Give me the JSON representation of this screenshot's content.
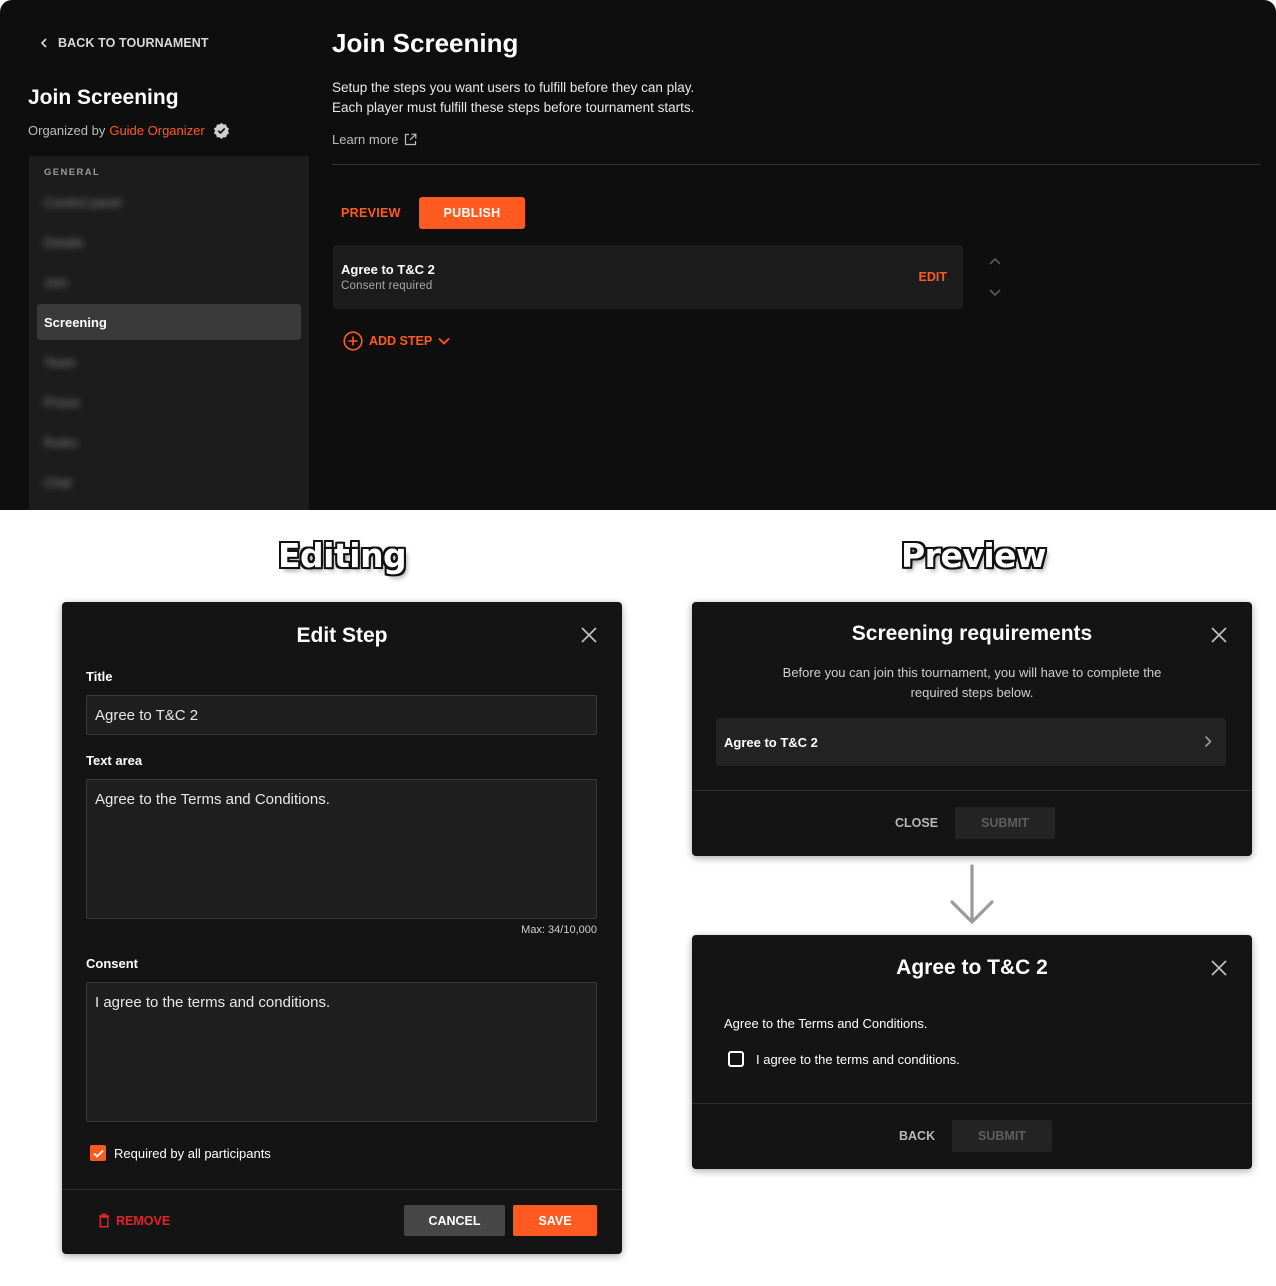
{
  "app": {
    "back_label": "BACK TO TOURNAMENT",
    "sidebar_title": "Join Screening",
    "organized_prefix": "Organized by",
    "organizer_name": "Guide Organizer",
    "nav_section": "GENERAL",
    "nav_items": [
      "Control panel",
      "Details",
      "Join",
      "Screening",
      "Team",
      "Prizes",
      "Rules",
      "Chat"
    ],
    "active_nav": "Screening",
    "page_title": "Join Screening",
    "description_line1": "Setup the steps you want users to fulfill before they can play.",
    "description_line2": "Each player must fulfill these steps before tournament starts.",
    "learn_more": "Learn more",
    "preview_label": "PREVIEW",
    "publish_label": "PUBLISH",
    "step": {
      "title": "Agree to T&C 2",
      "subtitle": "Consent required",
      "edit_label": "EDIT"
    },
    "add_step_label": "ADD STEP",
    "accent_color": "#ff5a1f"
  },
  "headings": {
    "editing": "Editing",
    "preview": "Preview"
  },
  "edit_modal": {
    "title": "Edit Step",
    "title_label": "Title",
    "title_value": "Agree to T&C 2",
    "text_area_label": "Text area",
    "text_area_value": "Agree to the Terms and Conditions.",
    "max_counter": "Max: 34/10,000",
    "consent_label": "Consent",
    "consent_value": "I agree to the terms and conditions.",
    "required_label": "Required by all participants",
    "required_checked": true,
    "remove_label": "REMOVE",
    "cancel_label": "CANCEL",
    "save_label": "SAVE"
  },
  "screening_modal": {
    "title": "Screening requirements",
    "description_line1": "Before you can join this tournament, you will have to complete the",
    "description_line2": "required steps below.",
    "requirement": "Agree to T&C 2",
    "close_label": "CLOSE",
    "submit_label": "SUBMIT"
  },
  "tc_modal": {
    "title": "Agree to T&C 2",
    "text": "Agree to the Terms and Conditions.",
    "checkbox_label": "I agree to the terms and conditions.",
    "back_label": "BACK",
    "submit_label": "SUBMIT"
  }
}
